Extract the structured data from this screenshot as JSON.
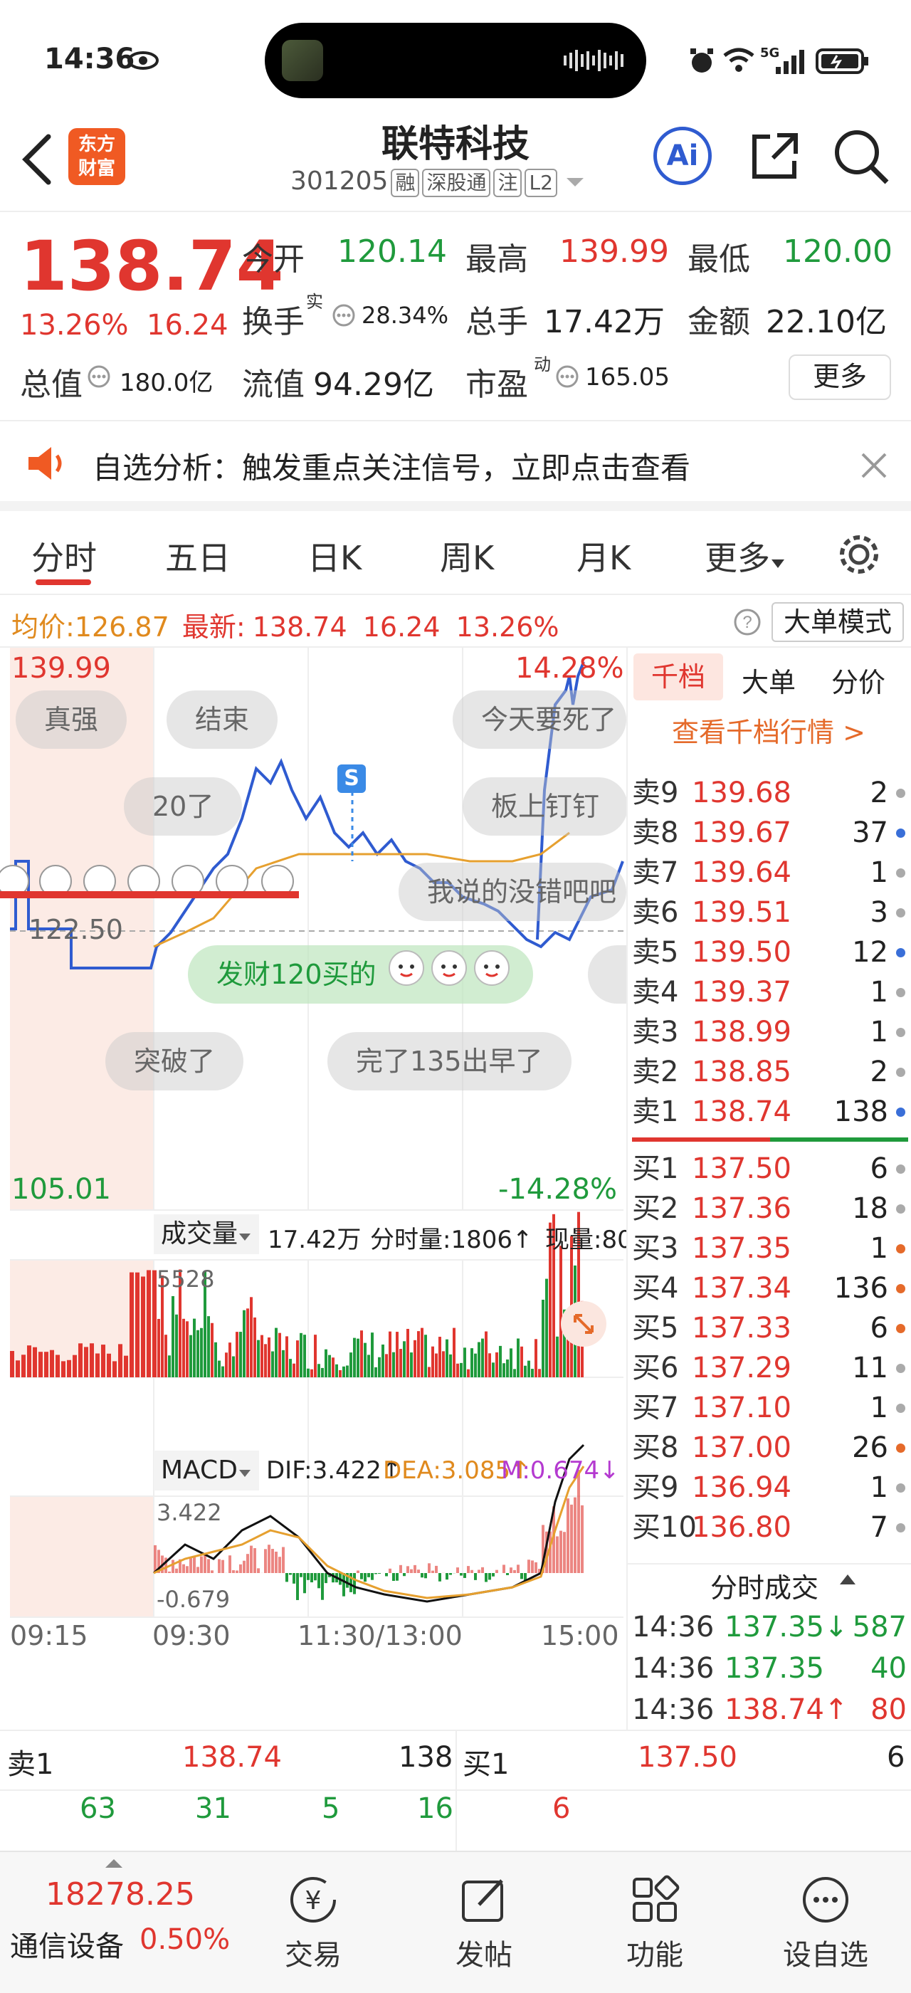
{
  "status": {
    "time": "14:36",
    "network": "5G"
  },
  "header": {
    "title": "联特科技",
    "code": "301205",
    "tags": [
      "融",
      "深股通",
      "注",
      "L2"
    ],
    "logo_line1": "东方",
    "logo_line2": "财富",
    "ai_label": "Ai"
  },
  "quote": {
    "price": "138.74",
    "change_pct": "13.26%",
    "change": "16.24",
    "open_label": "今开",
    "open": "120.14",
    "high_label": "最高",
    "high": "139.99",
    "low_label": "最低",
    "low": "120.00",
    "turnover_label": "换手",
    "turnover_sup": "实",
    "turnover": "28.34%",
    "volume_label": "总手",
    "volume": "17.42万",
    "amount_label": "金额",
    "amount": "22.10亿",
    "mcap_label": "总值",
    "mcap": "180.0亿",
    "float_label": "流值",
    "float": "94.29亿",
    "pe_label": "市盈",
    "pe_sup": "动",
    "pe": "165.05",
    "more_label": "更多"
  },
  "notice": {
    "text": "自选分析：触发重点关注信号，立即点击查看"
  },
  "tabs": {
    "items": [
      "分时",
      "五日",
      "日K",
      "周K",
      "月K",
      "更多"
    ],
    "active": "分时"
  },
  "infobar": {
    "avg_label": "均价:",
    "avg": "126.87",
    "latest_label": "最新:",
    "latest": "138.74",
    "change": "16.24",
    "pct": "13.26%",
    "mode_label": "大单模式"
  },
  "chart": {
    "high": "139.99",
    "high_pct": "14.28%",
    "low": "105.01",
    "low_pct": "-14.28%",
    "mid": "122.50",
    "s_marker": "S",
    "danmu": [
      "真强",
      "结束",
      "今天要死了",
      "20了",
      "板上钉钉",
      "我说的没错吧吧",
      "发财120买的",
      "突破了",
      "完了135出早了"
    ],
    "volume_label": "成交量",
    "volume_total": "17.42万",
    "tick_vol": "分时量:1806↑",
    "now_vol": "现量:80",
    "vol_max": "5528",
    "macd_label": "MACD",
    "dif": "DIF:3.422↑",
    "dea": "DEA:3.085↑",
    "m": "M:0.674↓",
    "macd_max": "3.422",
    "macd_min": "-0.679",
    "times": [
      "09:15",
      "09:30",
      "11:30/13:00",
      "15:00"
    ]
  },
  "book": {
    "tabs": [
      "千档",
      "大单",
      "分价"
    ],
    "link": "查看千档行情 >",
    "asks": [
      {
        "label": "卖9",
        "price": "139.68",
        "vol": "2",
        "dot": "#aaaaaa"
      },
      {
        "label": "卖8",
        "price": "139.67",
        "vol": "37",
        "dot": "#3a6fd8"
      },
      {
        "label": "卖7",
        "price": "139.64",
        "vol": "1",
        "dot": "#aaaaaa"
      },
      {
        "label": "卖6",
        "price": "139.51",
        "vol": "3",
        "dot": "#aaaaaa"
      },
      {
        "label": "卖5",
        "price": "139.50",
        "vol": "12",
        "dot": "#3a6fd8"
      },
      {
        "label": "卖4",
        "price": "139.37",
        "vol": "1",
        "dot": "#aaaaaa"
      },
      {
        "label": "卖3",
        "price": "138.99",
        "vol": "1",
        "dot": "#aaaaaa"
      },
      {
        "label": "卖2",
        "price": "138.85",
        "vol": "2",
        "dot": "#aaaaaa"
      },
      {
        "label": "卖1",
        "price": "138.74",
        "vol": "138",
        "dot": "#3a6fd8"
      }
    ],
    "bids": [
      {
        "label": "买1",
        "price": "137.50",
        "vol": "6",
        "dot": "#aaaaaa"
      },
      {
        "label": "买2",
        "price": "137.36",
        "vol": "18",
        "dot": "#aaaaaa"
      },
      {
        "label": "买3",
        "price": "137.35",
        "vol": "1",
        "dot": "#e56a2a"
      },
      {
        "label": "买4",
        "price": "137.34",
        "vol": "136",
        "dot": "#e56a2a"
      },
      {
        "label": "买5",
        "price": "137.33",
        "vol": "6",
        "dot": "#e56a2a"
      },
      {
        "label": "买6",
        "price": "137.29",
        "vol": "11",
        "dot": "#aaaaaa"
      },
      {
        "label": "买7",
        "price": "137.10",
        "vol": "1",
        "dot": "#aaaaaa"
      },
      {
        "label": "买8",
        "price": "137.00",
        "vol": "26",
        "dot": "#e56a2a"
      },
      {
        "label": "买9",
        "price": "136.94",
        "vol": "1",
        "dot": "#aaaaaa"
      },
      {
        "label": "买10",
        "price": "136.80",
        "vol": "7",
        "dot": "#aaaaaa"
      }
    ],
    "trades_title": "分时成交",
    "trades": [
      {
        "time": "14:36",
        "price": "137.35↓",
        "vol": "587",
        "color": "#1f9a3c"
      },
      {
        "time": "14:36",
        "price": "137.35",
        "vol": "40",
        "color": "#1f9a3c"
      },
      {
        "time": "14:36",
        "price": "138.74↑",
        "vol": "80",
        "color": "#e0362f"
      }
    ]
  },
  "bottombook": {
    "ask_label": "卖1",
    "ask_price": "138.74",
    "ask_vol": "138",
    "bid_label": "买1",
    "bid_price": "137.50",
    "bid_vol": "6",
    "ask_breakdown": [
      "63",
      "31",
      "5",
      "16"
    ],
    "bid_breakdown": [
      "6"
    ]
  },
  "nav": {
    "index_value": "18278.25",
    "index_name": "通信设备",
    "index_pct": "0.50%",
    "items": [
      "交易",
      "发帖",
      "功能",
      "设自选"
    ]
  }
}
